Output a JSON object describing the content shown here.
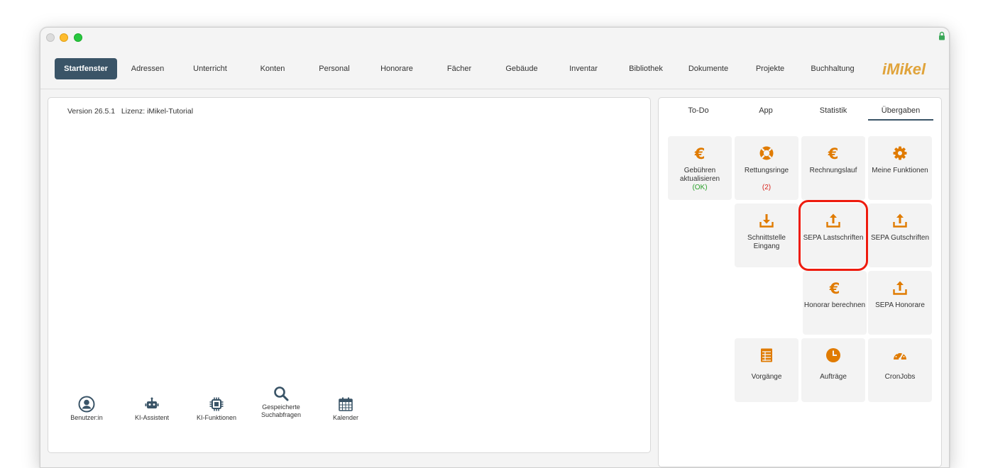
{
  "window": {
    "lock_icon": "lock-icon"
  },
  "nav": {
    "items": [
      {
        "label": "Startfenster"
      },
      {
        "label": "Adressen"
      },
      {
        "label": "Unterricht"
      },
      {
        "label": "Konten"
      },
      {
        "label": "Personal"
      },
      {
        "label": "Honorare"
      },
      {
        "label": "Fächer"
      },
      {
        "label": "Gebäude"
      },
      {
        "label": "Inventar"
      },
      {
        "label": "Bibliothek"
      },
      {
        "label": "Dokumente"
      },
      {
        "label": "Projekte"
      },
      {
        "label": "Buchhaltung"
      }
    ],
    "active_label": "Startfenster",
    "active_color": "#3a5467",
    "logo_text": "iMikel"
  },
  "left": {
    "version": "Version 26.5.1",
    "license": "Lizenz: iMikel-Tutorial",
    "tools": [
      {
        "label": "Benutzer:in",
        "icon": "user-icon"
      },
      {
        "label": "KI-Assistent",
        "icon": "robot-icon"
      },
      {
        "label": "KI-Funktionen",
        "icon": "chip-icon"
      },
      {
        "label": "Gespeicherte Suchabfragen",
        "icon": "search-icon"
      },
      {
        "label": "Kalender",
        "icon": "calendar-icon"
      }
    ]
  },
  "right": {
    "tabs": [
      {
        "label": "To-Do"
      },
      {
        "label": "App"
      },
      {
        "label": "Statistik"
      },
      {
        "label": "Übergaben"
      }
    ],
    "active_tab": "Übergaben",
    "accent_color": "#e07b00",
    "tiles": [
      {
        "label": "Gebühren aktualisieren",
        "status": "(OK)",
        "icon": "euro-icon"
      },
      {
        "label": "Rettungsringe",
        "status": "(2)",
        "icon": "lifebuoy-icon"
      },
      {
        "label": "Rechnungslauf",
        "icon": "euro-icon"
      },
      {
        "label": "Meine Funktionen",
        "icon": "gear-icon"
      },
      {
        "label": "Schnittstelle Eingang",
        "icon": "download-icon"
      },
      {
        "label": "SEPA Lastschriften",
        "icon": "upload-icon",
        "highlighted": true
      },
      {
        "label": "SEPA Gutschriften",
        "icon": "upload-icon"
      },
      {
        "label": "Honorar berechnen",
        "icon": "euro-icon"
      },
      {
        "label": "SEPA Honorare",
        "icon": "upload-icon"
      },
      {
        "label": "Vorgänge",
        "icon": "table-icon"
      },
      {
        "label": "Aufträge",
        "icon": "clock-icon"
      },
      {
        "label": "CronJobs",
        "icon": "gauge-icon"
      }
    ],
    "highlight_color": "#ee1b0e"
  }
}
